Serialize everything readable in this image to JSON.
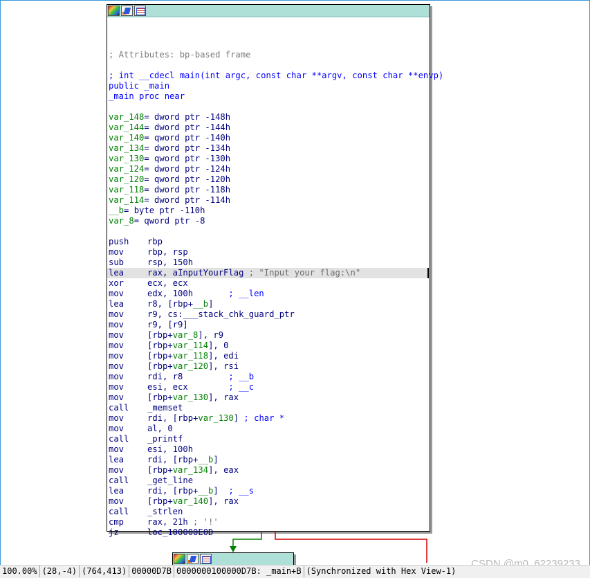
{
  "graph": {
    "main_node": {
      "title_icons": [
        "palette-icon",
        "rename-icon",
        "graph-icon"
      ],
      "lines": [
        {
          "id": "l0",
          "segs": [
            {
              "t": "",
              "c": ""
            }
          ]
        },
        {
          "id": "l1",
          "segs": [
            {
              "t": "; Attributes: bp-based frame",
              "c": "c-cmt"
            }
          ]
        },
        {
          "id": "l2",
          "segs": [
            {
              "t": "",
              "c": ""
            }
          ]
        },
        {
          "id": "l3",
          "segs": [
            {
              "t": "; int __cdecl main(int argc, const char **argv, const char **envp)",
              "c": "c-blue"
            }
          ]
        },
        {
          "id": "l4",
          "segs": [
            {
              "t": "public _main",
              "c": "c-blue"
            }
          ]
        },
        {
          "id": "l5",
          "segs": [
            {
              "t": "_main proc near",
              "c": "c-blue"
            }
          ]
        },
        {
          "id": "l6",
          "segs": [
            {
              "t": "",
              "c": ""
            }
          ]
        },
        {
          "id": "l7",
          "segs": [
            {
              "t": "var_148",
              "c": "c-grn"
            },
            {
              "t": "= dword ptr -148h",
              "c": "c-navy"
            }
          ]
        },
        {
          "id": "l8",
          "segs": [
            {
              "t": "var_144",
              "c": "c-grn"
            },
            {
              "t": "= dword ptr -144h",
              "c": "c-navy"
            }
          ]
        },
        {
          "id": "l9",
          "segs": [
            {
              "t": "var_140",
              "c": "c-grn"
            },
            {
              "t": "= qword ptr -140h",
              "c": "c-navy"
            }
          ]
        },
        {
          "id": "l10",
          "segs": [
            {
              "t": "var_134",
              "c": "c-grn"
            },
            {
              "t": "= dword ptr -134h",
              "c": "c-navy"
            }
          ]
        },
        {
          "id": "l11",
          "segs": [
            {
              "t": "var_130",
              "c": "c-grn"
            },
            {
              "t": "= qword ptr -130h",
              "c": "c-navy"
            }
          ]
        },
        {
          "id": "l12",
          "segs": [
            {
              "t": "var_124",
              "c": "c-grn"
            },
            {
              "t": "= dword ptr -124h",
              "c": "c-navy"
            }
          ]
        },
        {
          "id": "l13",
          "segs": [
            {
              "t": "var_120",
              "c": "c-grn"
            },
            {
              "t": "= qword ptr -120h",
              "c": "c-navy"
            }
          ]
        },
        {
          "id": "l14",
          "segs": [
            {
              "t": "var_118",
              "c": "c-grn"
            },
            {
              "t": "= dword ptr -118h",
              "c": "c-navy"
            }
          ]
        },
        {
          "id": "l15",
          "segs": [
            {
              "t": "var_114",
              "c": "c-grn"
            },
            {
              "t": "= dword ptr -114h",
              "c": "c-navy"
            }
          ]
        },
        {
          "id": "l16",
          "segs": [
            {
              "t": "__b",
              "c": "c-grn"
            },
            {
              "t": "= byte ptr -110h",
              "c": "c-navy"
            }
          ]
        },
        {
          "id": "l17",
          "segs": [
            {
              "t": "var_8",
              "c": "c-grn"
            },
            {
              "t": "= qword ptr -8",
              "c": "c-navy"
            }
          ]
        },
        {
          "id": "l18",
          "segs": [
            {
              "t": "",
              "c": ""
            }
          ]
        },
        {
          "id": "l19",
          "m": "push",
          "segs": [
            {
              "t": "rbp",
              "c": "c-navy"
            }
          ]
        },
        {
          "id": "l20",
          "m": "mov",
          "segs": [
            {
              "t": "rbp, rsp",
              "c": "c-navy"
            }
          ]
        },
        {
          "id": "l21",
          "m": "sub",
          "segs": [
            {
              "t": "rsp, 150h",
              "c": "c-navy"
            }
          ]
        },
        {
          "id": "l22",
          "m": "lea",
          "sel": true,
          "segs": [
            {
              "t": "rax, aInputYourFlag",
              "c": "c-navy"
            },
            {
              "t": " ; \"Input your flag:\\n\"",
              "c": "c-str"
            }
          ]
        },
        {
          "id": "l23",
          "m": "xor",
          "segs": [
            {
              "t": "ecx, ecx",
              "c": "c-navy"
            }
          ]
        },
        {
          "id": "l24",
          "m": "mov",
          "segs": [
            {
              "t": "edx, 100h",
              "c": "c-navy"
            },
            {
              "t": "       ; __len",
              "c": "c-blue"
            }
          ]
        },
        {
          "id": "l25",
          "m": "lea",
          "segs": [
            {
              "t": "r8, [rbp+",
              "c": "c-navy"
            },
            {
              "t": "__b",
              "c": "c-grn"
            },
            {
              "t": "]",
              "c": "c-navy"
            }
          ]
        },
        {
          "id": "l26",
          "m": "mov",
          "segs": [
            {
              "t": "r9, cs:___stack_chk_guard_ptr",
              "c": "c-navy"
            }
          ]
        },
        {
          "id": "l27",
          "m": "mov",
          "segs": [
            {
              "t": "r9, [r9]",
              "c": "c-navy"
            }
          ]
        },
        {
          "id": "l28",
          "m": "mov",
          "segs": [
            {
              "t": "[rbp+",
              "c": "c-navy"
            },
            {
              "t": "var_8",
              "c": "c-grn"
            },
            {
              "t": "], r9",
              "c": "c-navy"
            }
          ]
        },
        {
          "id": "l29",
          "m": "mov",
          "segs": [
            {
              "t": "[rbp+",
              "c": "c-navy"
            },
            {
              "t": "var_114",
              "c": "c-grn"
            },
            {
              "t": "], 0",
              "c": "c-navy"
            }
          ]
        },
        {
          "id": "l30",
          "m": "mov",
          "segs": [
            {
              "t": "[rbp+",
              "c": "c-navy"
            },
            {
              "t": "var_118",
              "c": "c-grn"
            },
            {
              "t": "], edi",
              "c": "c-navy"
            }
          ]
        },
        {
          "id": "l31",
          "m": "mov",
          "segs": [
            {
              "t": "[rbp+",
              "c": "c-navy"
            },
            {
              "t": "var_120",
              "c": "c-grn"
            },
            {
              "t": "], rsi",
              "c": "c-navy"
            }
          ]
        },
        {
          "id": "l32",
          "m": "mov",
          "segs": [
            {
              "t": "rdi, r8",
              "c": "c-navy"
            },
            {
              "t": "         ; __b",
              "c": "c-blue"
            }
          ]
        },
        {
          "id": "l33",
          "m": "mov",
          "segs": [
            {
              "t": "esi, ecx",
              "c": "c-navy"
            },
            {
              "t": "        ; __c",
              "c": "c-blue"
            }
          ]
        },
        {
          "id": "l34",
          "m": "mov",
          "segs": [
            {
              "t": "[rbp+",
              "c": "c-navy"
            },
            {
              "t": "var_130",
              "c": "c-grn"
            },
            {
              "t": "], rax",
              "c": "c-navy"
            }
          ]
        },
        {
          "id": "l35",
          "m": "call",
          "segs": [
            {
              "t": "_memset",
              "c": "c-navy"
            }
          ]
        },
        {
          "id": "l36",
          "m": "mov",
          "segs": [
            {
              "t": "rdi, [rbp+",
              "c": "c-navy"
            },
            {
              "t": "var_130",
              "c": "c-grn"
            },
            {
              "t": "]",
              "c": "c-navy"
            },
            {
              "t": " ; char *",
              "c": "c-blue"
            }
          ]
        },
        {
          "id": "l37",
          "m": "mov",
          "segs": [
            {
              "t": "al, 0",
              "c": "c-navy"
            }
          ]
        },
        {
          "id": "l38",
          "m": "call",
          "segs": [
            {
              "t": "_printf",
              "c": "c-navy"
            }
          ]
        },
        {
          "id": "l39",
          "m": "mov",
          "segs": [
            {
              "t": "esi, 100h",
              "c": "c-navy"
            }
          ]
        },
        {
          "id": "l40",
          "m": "lea",
          "segs": [
            {
              "t": "rdi, [rbp+",
              "c": "c-navy"
            },
            {
              "t": "__b",
              "c": "c-grn"
            },
            {
              "t": "]",
              "c": "c-navy"
            }
          ]
        },
        {
          "id": "l41",
          "m": "mov",
          "segs": [
            {
              "t": "[rbp+",
              "c": "c-navy"
            },
            {
              "t": "var_134",
              "c": "c-grn"
            },
            {
              "t": "], eax",
              "c": "c-navy"
            }
          ]
        },
        {
          "id": "l42",
          "m": "call",
          "segs": [
            {
              "t": "_get_line",
              "c": "c-navy"
            }
          ]
        },
        {
          "id": "l43",
          "m": "lea",
          "segs": [
            {
              "t": "rdi, [rbp+",
              "c": "c-navy"
            },
            {
              "t": "__b",
              "c": "c-grn"
            },
            {
              "t": "]",
              "c": "c-navy"
            },
            {
              "t": "  ; __s",
              "c": "c-blue"
            }
          ]
        },
        {
          "id": "l44",
          "m": "mov",
          "segs": [
            {
              "t": "[rbp+",
              "c": "c-navy"
            },
            {
              "t": "var_140",
              "c": "c-grn"
            },
            {
              "t": "], rax",
              "c": "c-navy"
            }
          ]
        },
        {
          "id": "l45",
          "m": "call",
          "segs": [
            {
              "t": "_strlen",
              "c": "c-navy"
            }
          ]
        },
        {
          "id": "l46",
          "m": "cmp",
          "segs": [
            {
              "t": "rax, 21h",
              "c": "c-navy"
            },
            {
              "t": " ; '!'",
              "c": "c-str"
            }
          ]
        },
        {
          "id": "l47",
          "m": "jz",
          "segs": [
            {
              "t": "loc_100000E0D",
              "c": "c-navy"
            }
          ]
        }
      ]
    },
    "colors": {
      "edge_true": "#008000",
      "edge_false": "#d40000",
      "title_bar": "#aee0d8"
    }
  },
  "statusbar": {
    "zoom": "100.00%",
    "offset": "(28,-4)",
    "mouse": "(764,413)",
    "file_offset": "00000D7B",
    "address": "0000000100000D7B: _main+B",
    "sync": "(Synchronized with Hex View-1)"
  },
  "watermark": "CSDN @m0_62239233"
}
